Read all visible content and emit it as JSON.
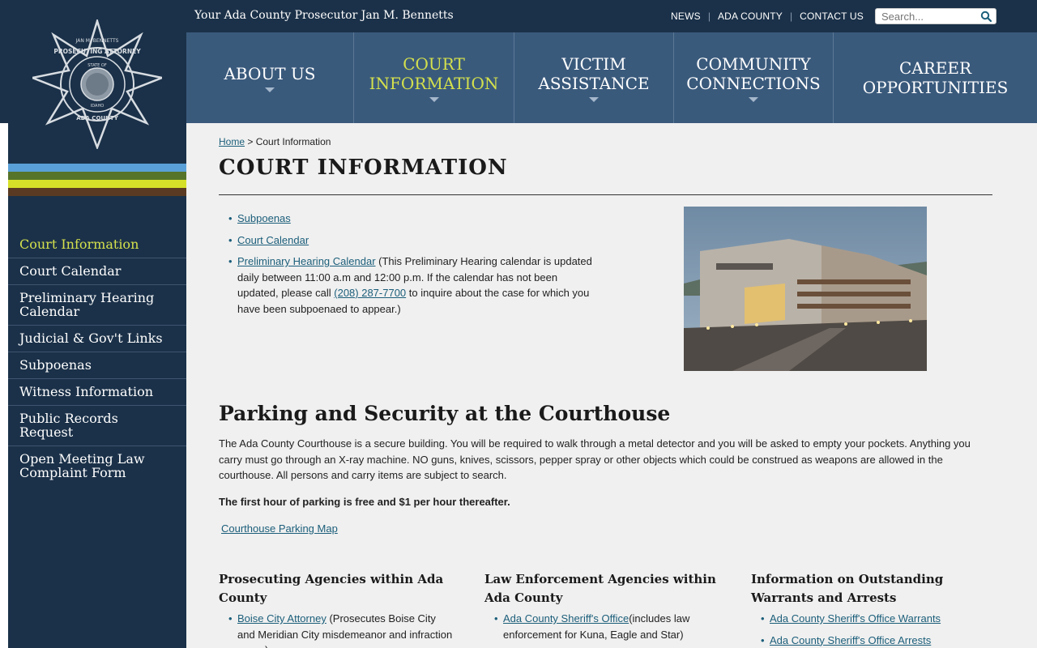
{
  "header": {
    "tagline": "Your Ada County Prosecutor Jan M. Bennetts",
    "util_links": [
      "NEWS",
      "ADA COUNTY",
      "CONTACT US"
    ],
    "search_placeholder": "Search..."
  },
  "logo": {
    "text_ring": "PROSECUTING ATTORNEY",
    "text_top": "JAN M. BENNETTS",
    "text_bottom": "ADA COUNTY",
    "seal_top": "STATE OF",
    "seal_bottom": "IDAHO"
  },
  "stripe_colors": [
    "#5aa0d8",
    "#56742a",
    "#d6e028",
    "#5a3a22"
  ],
  "mainnav": [
    {
      "line1": "ABOUT US",
      "line2": "",
      "active": false
    },
    {
      "line1": "COURT",
      "line2": "INFORMATION",
      "active": true
    },
    {
      "line1": "VICTIM",
      "line2": "ASSISTANCE",
      "active": false
    },
    {
      "line1": "COMMUNITY",
      "line2": "CONNECTIONS",
      "active": false
    },
    {
      "line1": "CAREER",
      "line2": "OPPORTUNITIES",
      "active": false
    }
  ],
  "sidenav": [
    {
      "label": "Court Information",
      "active": true
    },
    {
      "label": "Court Calendar",
      "active": false
    },
    {
      "label": "Preliminary Hearing Calendar",
      "active": false
    },
    {
      "label": "Judicial & Gov't Links",
      "active": false
    },
    {
      "label": "Subpoenas",
      "active": false
    },
    {
      "label": "Witness Information",
      "active": false
    },
    {
      "label": "Public Records Request",
      "active": false
    },
    {
      "label": "Open Meeting Law Complaint Form",
      "active": false
    }
  ],
  "breadcrumb": {
    "home": "Home",
    "separator": " > ",
    "current": "Court Information"
  },
  "page_title": "COURT INFORMATION",
  "links": {
    "subpoenas": "Subpoenas",
    "court_calendar": "Court Calendar",
    "prelim": "Preliminary Hearing Calendar",
    "prelim_text_1": " (This Preliminary Hearing calendar is updated daily between 11:00 a.m and 12:00 p.m. If the calendar has not been updated, please call ",
    "phone": "(208) 287-7700",
    "prelim_text_2": " to inquire about the case for which you have been subpoenaed to appear.)"
  },
  "parking": {
    "title": "Parking and Security at the Courthouse",
    "text": "The Ada County Courthouse is a secure building.  You will be required to walk through a metal detector and you will be asked to empty your pockets.  Anything you carry must go through an X-ray machine.  NO guns, knives, scissors, pepper spray or other objects which could be construed as weapons are allowed in the courthouse.  All persons and carry items are subject to search.",
    "bold": "The first hour of parking is free and $1 per hour thereafter.",
    "map_link": "Courthouse Parking Map"
  },
  "columns": [
    {
      "title": "Prosecuting Agencies within Ada County",
      "items": [
        {
          "link": "Boise City Attorney",
          "text": " (Prosecutes Boise City and Meridian City misdemeanor and infraction cases)"
        }
      ]
    },
    {
      "title": "Law Enforcement Agencies within Ada County",
      "items": [
        {
          "link": "Ada County Sheriff's Office",
          "text": "(includes law enforcement for Kuna, Eagle and Star)"
        }
      ]
    },
    {
      "title": "Information on Outstanding Warrants and Arrests",
      "items": [
        {
          "link": "Ada County Sheriff's Office Warrants",
          "text": ""
        },
        {
          "link": "Ada County Sheriff's Office Arrests",
          "text": ""
        }
      ]
    }
  ]
}
